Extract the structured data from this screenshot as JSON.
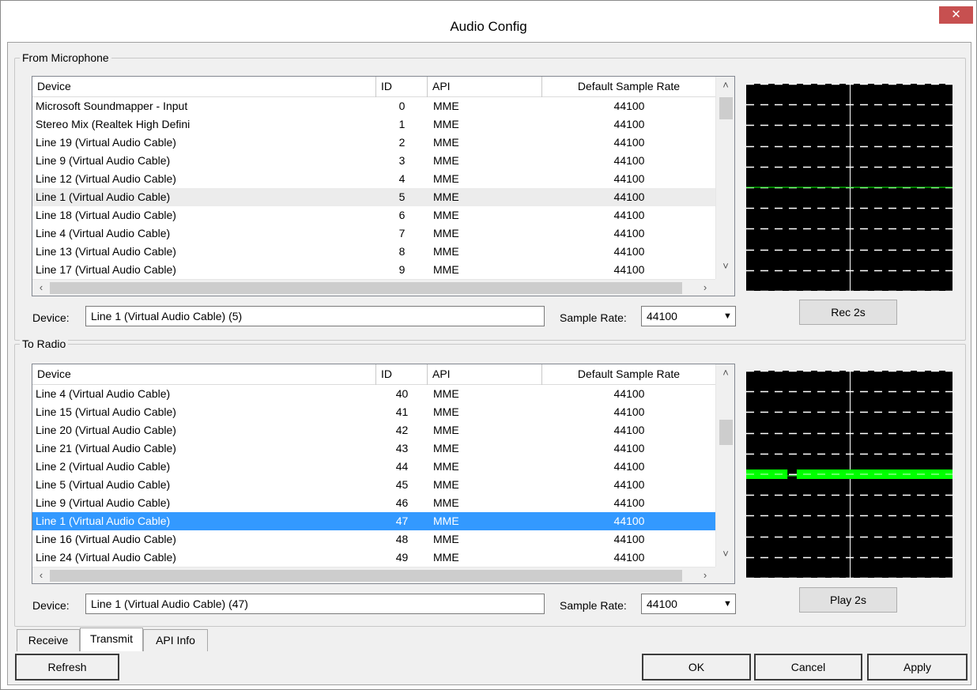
{
  "window": {
    "title": "Audio Config",
    "close_glyph": "✕"
  },
  "mic": {
    "group_label": "From Microphone",
    "columns": [
      "Device",
      "ID",
      "API",
      "Default Sample Rate"
    ],
    "rows": [
      [
        "Microsoft Soundmapper - Input",
        "0",
        "MME",
        "44100"
      ],
      [
        "Stereo Mix (Realtek High Defini",
        "1",
        "MME",
        "44100"
      ],
      [
        "Line 19 (Virtual Audio Cable)",
        "2",
        "MME",
        "44100"
      ],
      [
        "Line 9 (Virtual Audio Cable)",
        "3",
        "MME",
        "44100"
      ],
      [
        "Line 12 (Virtual Audio Cable)",
        "4",
        "MME",
        "44100"
      ],
      [
        "Line 1 (Virtual Audio Cable)",
        "5",
        "MME",
        "44100"
      ],
      [
        "Line 18 (Virtual Audio Cable)",
        "6",
        "MME",
        "44100"
      ],
      [
        "Line 4 (Virtual Audio Cable)",
        "7",
        "MME",
        "44100"
      ],
      [
        "Line 13 (Virtual Audio Cable)",
        "8",
        "MME",
        "44100"
      ],
      [
        "Line 17 (Virtual Audio Cable)",
        "9",
        "MME",
        "44100"
      ]
    ],
    "hover_row": 5,
    "device_label": "Device:",
    "device_value": "Line 1 (Virtual Audio Cable) (5)",
    "sample_rate_label": "Sample Rate:",
    "sample_rate_value": "44100",
    "action_button": "Rec 2s"
  },
  "radio": {
    "group_label": "To Radio",
    "columns": [
      "Device",
      "ID",
      "API",
      "Default Sample Rate"
    ],
    "rows": [
      [
        "Line 4 (Virtual Audio Cable)",
        "40",
        "MME",
        "44100"
      ],
      [
        "Line 15 (Virtual Audio Cable)",
        "41",
        "MME",
        "44100"
      ],
      [
        "Line 20 (Virtual Audio Cable)",
        "42",
        "MME",
        "44100"
      ],
      [
        "Line 21 (Virtual Audio Cable)",
        "43",
        "MME",
        "44100"
      ],
      [
        "Line 2 (Virtual Audio Cable)",
        "44",
        "MME",
        "44100"
      ],
      [
        "Line 5 (Virtual Audio Cable)",
        "45",
        "MME",
        "44100"
      ],
      [
        "Line 9 (Virtual Audio Cable)",
        "46",
        "MME",
        "44100"
      ],
      [
        "Line 1 (Virtual Audio Cable)",
        "47",
        "MME",
        "44100"
      ],
      [
        "Line 16 (Virtual Audio Cable)",
        "48",
        "MME",
        "44100"
      ],
      [
        "Line 24 (Virtual Audio Cable)",
        "49",
        "MME",
        "44100"
      ]
    ],
    "selected_row": 7,
    "device_label": "Device:",
    "device_value": "Line 1 (Virtual Audio Cable) (47)",
    "sample_rate_label": "Sample Rate:",
    "sample_rate_value": "44100",
    "action_button": "Play 2s"
  },
  "tabs": [
    "Receive",
    "Transmit",
    "API Info"
  ],
  "active_tab": "Transmit",
  "buttons": {
    "refresh": "Refresh",
    "ok": "OK",
    "cancel": "Cancel",
    "apply": "Apply"
  },
  "colors": {
    "scope_bg": "#000000",
    "scope_grid": "#ffffff",
    "scope_signal": "#00ff00",
    "selection": "#3399ff",
    "close_button": "#c75050"
  }
}
